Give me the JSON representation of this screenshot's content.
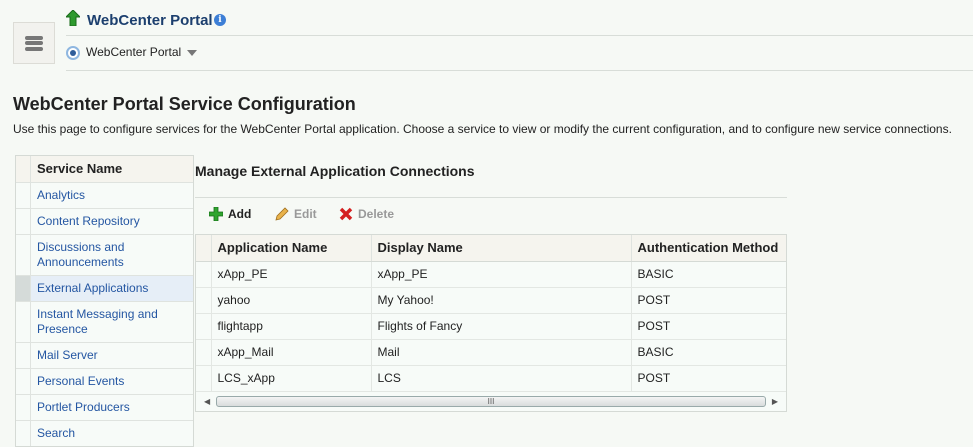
{
  "header": {
    "title": "WebCenter Portal",
    "selector": "WebCenter Portal"
  },
  "page": {
    "title": "WebCenter Portal Service Configuration",
    "description": "Use this page to configure services for the WebCenter Portal application. Choose a service to view or modify the current configuration, and to configure new service connections."
  },
  "sidebar": {
    "header": "Service Name",
    "items": [
      {
        "label": "Analytics"
      },
      {
        "label": "Content Repository"
      },
      {
        "label": "Discussions and Announcements"
      },
      {
        "label": "External Applications",
        "selected": true
      },
      {
        "label": "Instant Messaging and Presence"
      },
      {
        "label": "Mail Server"
      },
      {
        "label": "Personal Events"
      },
      {
        "label": "Portlet Producers"
      },
      {
        "label": "Search"
      }
    ]
  },
  "main": {
    "title": "Manage External Application Connections",
    "toolbar": {
      "add": "Add",
      "edit": "Edit",
      "delete": "Delete"
    },
    "columns": [
      "Application Name",
      "Display Name",
      "Authentication Method"
    ],
    "rows": [
      [
        "xApp_PE",
        "xApp_PE",
        "BASIC"
      ],
      [
        "yahoo",
        "My Yahoo!",
        "POST"
      ],
      [
        "flightapp",
        "Flights of Fancy",
        "POST"
      ],
      [
        "xApp_Mail",
        "Mail",
        "BASIC"
      ],
      [
        "LCS_xApp",
        "LCS",
        "POST"
      ]
    ],
    "scroll_grip": "III"
  }
}
